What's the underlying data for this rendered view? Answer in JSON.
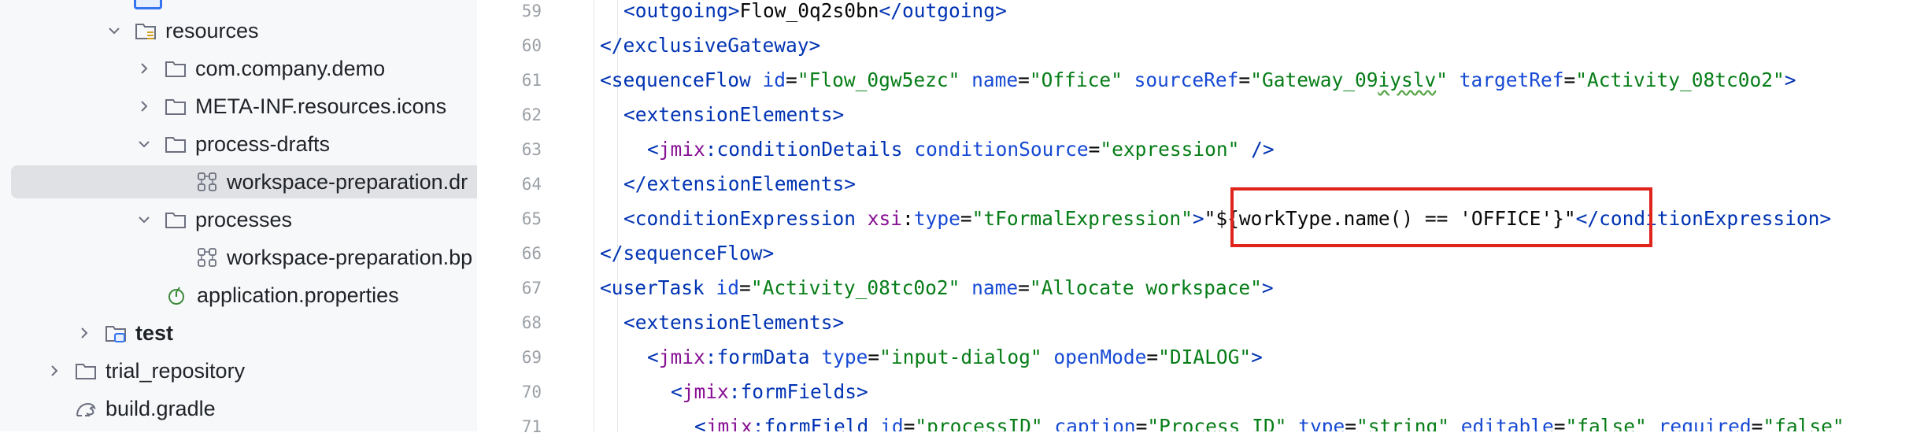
{
  "project_tree": {
    "items": [
      {
        "label": "resources",
        "icon": "resources-folder-icon",
        "expanded": true
      },
      {
        "label": "com.company.demo",
        "icon": "folder-icon",
        "expanded": false
      },
      {
        "label": "META-INF.resources.icons",
        "icon": "folder-icon",
        "expanded": false
      },
      {
        "label": "process-drafts",
        "icon": "folder-icon",
        "expanded": true
      },
      {
        "label": "workspace-preparation.dr",
        "icon": "bpmn-file-icon",
        "selected": true
      },
      {
        "label": "processes",
        "icon": "folder-icon",
        "expanded": true
      },
      {
        "label": "workspace-preparation.bp",
        "icon": "bpmn-file-icon"
      },
      {
        "label": "application.properties",
        "icon": "properties-file-icon"
      },
      {
        "label": "test",
        "icon": "test-folder-icon",
        "expanded": false
      },
      {
        "label": "trial_repository",
        "icon": "folder-icon",
        "expanded": false
      },
      {
        "label": "build.gradle",
        "icon": "gradle-icon"
      }
    ]
  },
  "editor": {
    "line_numbers": [
      "59",
      "60",
      "61",
      "62",
      "63",
      "64",
      "65",
      "66",
      "67",
      "68",
      "69",
      "70",
      "71"
    ],
    "lines": [
      "<outgoing>Flow_0q2s0bn</outgoing>",
      "</exclusiveGateway>",
      "<sequenceFlow id=\"Flow_0gw5ezc\" name=\"Office\" sourceRef=\"Gateway_09iyslv\" targetRef=\"Activity_08tc0o2\">",
      "<extensionElements>",
      "<jmix:conditionDetails conditionSource=\"expression\" />",
      "</extensionElements>",
      "<conditionExpression xsi:type=\"tFormalExpression\">\"${workType.name() == 'OFFICE'}\"</conditionExpression>",
      "</sequenceFlow>",
      "<userTask id=\"Activity_08tc0o2\" name=\"Allocate workspace\">",
      "<extensionElements>",
      "<jmix:formData type=\"input-dialog\" openMode=\"DIALOG\">",
      "<jmix:formFields>",
      "<jmix:formField id=\"processID\" caption=\"Process ID\" type=\"string\" editable=\"false\" required=\"false\""
    ],
    "highlight_note": "${workType.name() == 'OFFICE'}",
    "highlight_color": "#e0241c",
    "colors": {
      "tag": "#0033b3",
      "attribute": "#174ad4",
      "string": "#067d17",
      "namespace": "#871094"
    }
  }
}
